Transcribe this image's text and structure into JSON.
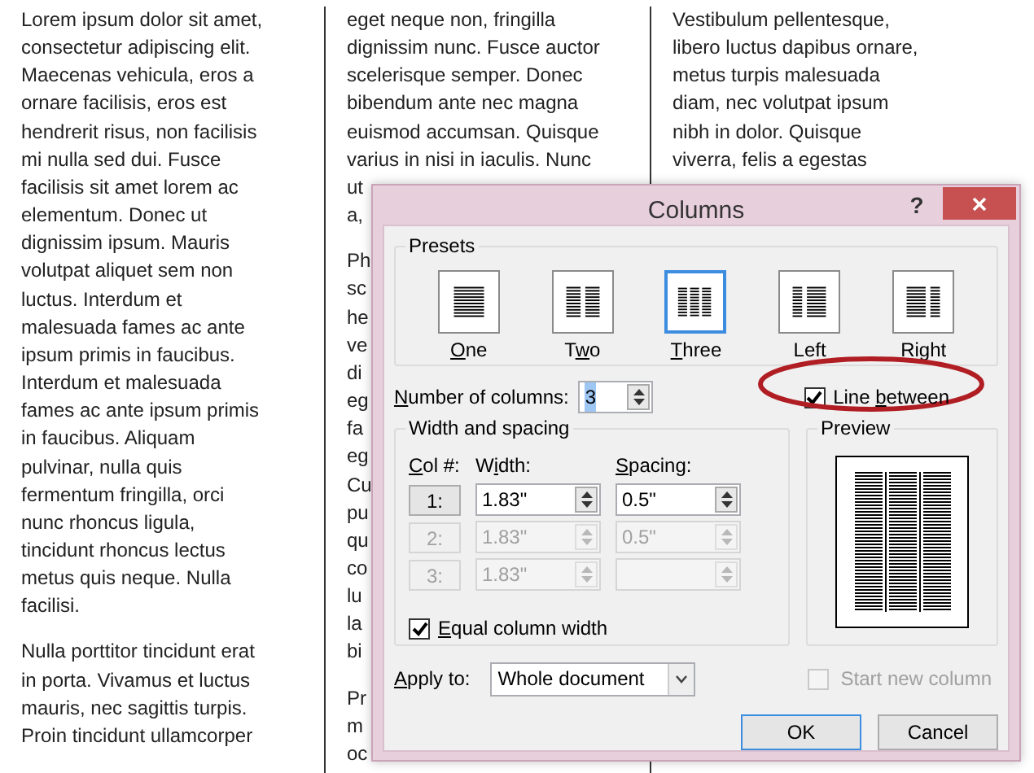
{
  "document": {
    "columns": [
      {
        "paragraphs": [
          {
            "lines": [
              "Lorem ipsum dolor sit amet,",
              "consectetur adipiscing elit.",
              "Maecenas vehicula, eros a",
              "ornare facilisis, eros est",
              "hendrerit risus, non facilisis",
              "mi nulla sed dui. Fusce",
              "facilisis sit amet lorem ac",
              "elementum. Donec ut",
              "dignissim ipsum. Mauris",
              "volutpat aliquet sem non",
              "luctus. Interdum et",
              "malesuada fames ac ante",
              "ipsum primis in faucibus.",
              "Interdum et malesuada",
              "fames ac ante ipsum primis",
              "in faucibus. Aliquam",
              "pulvinar, nulla quis",
              "fermentum fringilla, orci",
              "nunc rhoncus ligula,",
              "tincidunt rhoncus lectus",
              "metus quis neque. Nulla",
              "facilisi."
            ]
          },
          {
            "lines": [
              "Nulla porttitor tincidunt erat",
              "in porta. Vivamus et luctus",
              "mauris, nec sagittis turpis.",
              "Proin tincidunt ullamcorper"
            ]
          }
        ]
      },
      {
        "paragraphs": [
          {
            "lines": [
              "eget neque non, fringilla",
              "dignissim nunc. Fusce auctor",
              "scelerisque semper. Donec",
              "bibendum ante nec magna",
              "euismod accumsan. Quisque",
              "varius in nisi in iaculis. Nunc",
              "ut",
              "a,"
            ]
          },
          {
            "lines": [
              "Ph",
              "sc",
              "he",
              "ve",
              "di",
              "eg",
              "fa",
              "eg",
              "Cu",
              "pu",
              "qu",
              "co",
              "lu",
              "la",
              "bi"
            ]
          },
          {
            "lines": [
              "Pr",
              "m",
              "oc"
            ]
          }
        ]
      },
      {
        "paragraphs": [
          {
            "lines": [
              "Vestibulum pellentesque,",
              "libero luctus dapibus ornare,",
              "metus turpis malesuada",
              "diam, nec volutpat ipsum",
              "nibh in dolor. Quisque",
              "viverra, felis a egestas"
            ]
          }
        ]
      }
    ]
  },
  "dialog": {
    "title": "Columns",
    "help": "?",
    "presets": {
      "title": "Presets",
      "items": [
        {
          "kind": "one",
          "key": "O",
          "post": "ne",
          "selected": false
        },
        {
          "kind": "two",
          "pre": "T",
          "key": "w",
          "post": "o",
          "selected": false
        },
        {
          "kind": "three",
          "key": "T",
          "post": "hree",
          "selected": true
        },
        {
          "kind": "left",
          "pre": "Left",
          "selected": false
        },
        {
          "kind": "right",
          "pre": "Right",
          "selected": false
        }
      ]
    },
    "number_of_columns": {
      "label": {
        "key": "N",
        "post": "umber of columns:"
      },
      "value": "3"
    },
    "line_between": {
      "label": {
        "pre": "Line ",
        "key": "b",
        "post": "etween"
      },
      "checked": true,
      "circled": true
    },
    "width_and_spacing": {
      "title": "Width and spacing",
      "headers": [
        {
          "key": "C",
          "post": "ol #:"
        },
        {
          "pre": "W",
          "key": "i",
          "post": "dth:"
        },
        {
          "key": "S",
          "post": "pacing:"
        }
      ],
      "rows": [
        {
          "col": "1:",
          "width": "1.83\"",
          "spacing": "0.5\"",
          "disabled": false
        },
        {
          "col": "2:",
          "width": "1.83\"",
          "spacing": "0.5\"",
          "disabled": true
        },
        {
          "col": "3:",
          "width": "1.83\"",
          "disabled": true
        }
      ]
    },
    "equal_column_width": {
      "label": {
        "key": "E",
        "post": "qual column width"
      },
      "checked": true
    },
    "preview": {
      "title": "Preview"
    },
    "apply_to": {
      "label": {
        "key": "A",
        "post": "pply to:"
      },
      "value": "Whole document"
    },
    "start_new_column": {
      "label": {
        "pre": "Start new column"
      },
      "checked": false,
      "disabled": true
    },
    "buttons": [
      {
        "label": "OK",
        "default": true
      },
      {
        "label": "Cancel",
        "default": false
      }
    ]
  }
}
